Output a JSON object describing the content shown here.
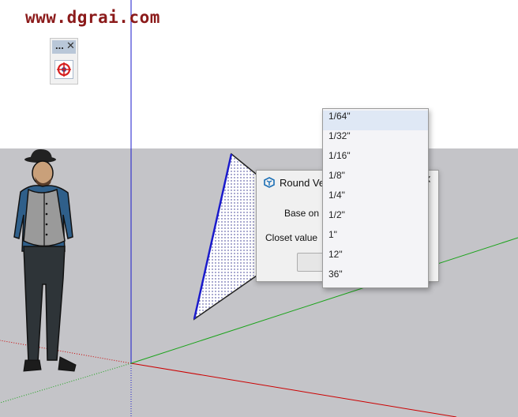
{
  "watermark": {
    "text": "www.dgrai.com"
  },
  "toolbar": {
    "title": "...",
    "close": "✕",
    "tool_icon": "crosshair-target-icon"
  },
  "dialog": {
    "title": "Round Ve",
    "base_on_label": "Base on",
    "closest_value_label": "Closet value",
    "close": "✕"
  },
  "dropdown": {
    "selected": "1/64\"",
    "options": [
      "1/64\"",
      "1/32\"",
      "1/16\"",
      "1/8\"",
      "1/4\"",
      "1/2\"",
      "1\"",
      "12\"",
      "36\""
    ]
  },
  "colors": {
    "sky": "#ffffff",
    "ground": "#c4c4c8",
    "watermark": "#8b1a1a",
    "axis_red": "#cc0000",
    "axis_green": "#1aa31a",
    "axis_blue": "#1a1acc",
    "dropdown_highlight": "#dfe8f5"
  }
}
